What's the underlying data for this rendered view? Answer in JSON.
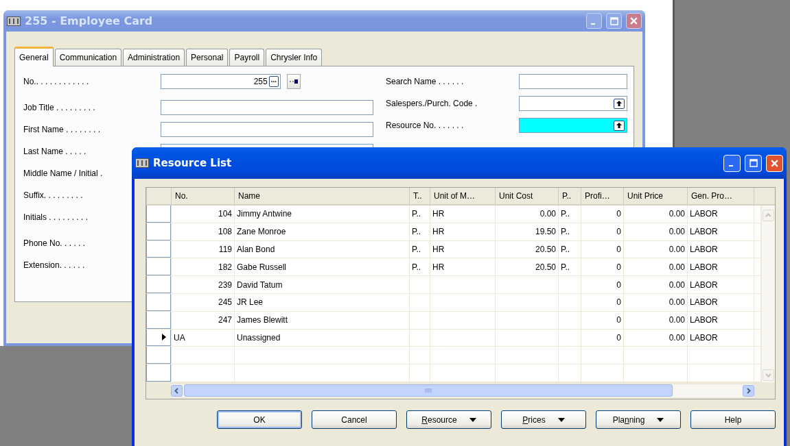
{
  "employee_window": {
    "title": "255 - Employee Card",
    "active": false,
    "tabs": [
      {
        "label": "General",
        "selected": true
      },
      {
        "label": "Communication",
        "selected": false
      },
      {
        "label": "Administration",
        "selected": false
      },
      {
        "label": "Personal",
        "selected": false
      },
      {
        "label": "Payroll",
        "selected": false
      },
      {
        "label": "Chrysler Info",
        "selected": false
      }
    ],
    "left_groups": [
      [
        {
          "label": "No.. . . . . . . . . . . .",
          "kind": "assist",
          "value": "255",
          "assist": "..."
        }
      ],
      [
        {
          "label": "Job Title . . . . . . . . .",
          "kind": "text"
        },
        {
          "label": "First Name . . . . . . . .",
          "kind": "text"
        },
        {
          "label": "Last Name . . . . .",
          "kind": "text"
        },
        {
          "label": "Middle Name / Initial .",
          "kind": "label"
        },
        {
          "label": "Suffix. . . . . . . . .",
          "kind": "label"
        },
        {
          "label": "Initials . . . . . . . . .",
          "kind": "label"
        }
      ],
      [
        {
          "label": "Phone No. . . . . .",
          "kind": "label"
        },
        {
          "label": "Extension. . . . . .",
          "kind": "label"
        }
      ]
    ],
    "right_fields": [
      {
        "label": "Search Name . . . . . .",
        "kind": "text",
        "highlighted": false
      },
      {
        "label": "Salespers./Purch. Code .",
        "kind": "lookup",
        "highlighted": false
      },
      {
        "label": "Resource No. . . . . . .",
        "kind": "lookup",
        "highlighted": true
      }
    ]
  },
  "resource_window": {
    "title": "Resource List",
    "active": true,
    "columns": [
      {
        "label": "No.",
        "kind": "number"
      },
      {
        "label": "Name",
        "kind": "text"
      },
      {
        "label": "T..",
        "kind": "text"
      },
      {
        "label": "Unit of M…",
        "kind": "text"
      },
      {
        "label": "Unit Cost",
        "kind": "number"
      },
      {
        "label": "P..",
        "kind": "text"
      },
      {
        "label": "Profi…",
        "kind": "number"
      },
      {
        "label": "Unit Price",
        "kind": "number"
      },
      {
        "label": "Gen. Pro…",
        "kind": "text"
      }
    ],
    "rows": [
      {
        "current": false,
        "kind": "number",
        "cells": [
          "104",
          "Jimmy Antwine",
          "P..",
          "HR",
          "0.00",
          "P..",
          "0",
          "0.00",
          "LABOR"
        ]
      },
      {
        "current": false,
        "kind": "number",
        "cells": [
          "108",
          "Zane Monroe",
          "P..",
          "HR",
          "19.50",
          "P..",
          "0",
          "0.00",
          "LABOR"
        ]
      },
      {
        "current": false,
        "kind": "number",
        "cells": [
          "119",
          "Alan Bond",
          "P..",
          "HR",
          "20.50",
          "P..",
          "0",
          "0.00",
          "LABOR"
        ]
      },
      {
        "current": false,
        "kind": "number",
        "cells": [
          "182",
          "Gabe Russell",
          "P..",
          "HR",
          "20.50",
          "P..",
          "0",
          "0.00",
          "LABOR"
        ]
      },
      {
        "current": false,
        "kind": "number",
        "cells": [
          "239",
          "David Tatum",
          "",
          "",
          "",
          "",
          "0",
          "0.00",
          "LABOR"
        ]
      },
      {
        "current": false,
        "kind": "number",
        "cells": [
          "245",
          "JR Lee",
          "",
          "",
          "",
          "",
          "0",
          "0.00",
          "LABOR"
        ]
      },
      {
        "current": false,
        "kind": "number",
        "cells": [
          "247",
          "James Blewitt",
          "",
          "",
          "",
          "",
          "0",
          "0.00",
          "LABOR"
        ]
      },
      {
        "current": true,
        "kind": "code",
        "cells": [
          "UA",
          "Unassigned",
          "",
          "",
          "",
          "",
          "0",
          "0.00",
          "LABOR"
        ]
      }
    ],
    "buttons": [
      {
        "pre": "OK",
        "default": true,
        "dropdown": false
      },
      {
        "pre": "Cancel",
        "default": false,
        "dropdown": false
      },
      {
        "key": "R",
        "post": "esource",
        "default": false,
        "dropdown": true
      },
      {
        "key": "P",
        "post": "rices",
        "default": false,
        "dropdown": true
      },
      {
        "pre": "Pla",
        "key": "n",
        "post": "ning",
        "default": false,
        "dropdown": true
      },
      {
        "pre": "Help",
        "default": false,
        "dropdown": false
      }
    ]
  }
}
